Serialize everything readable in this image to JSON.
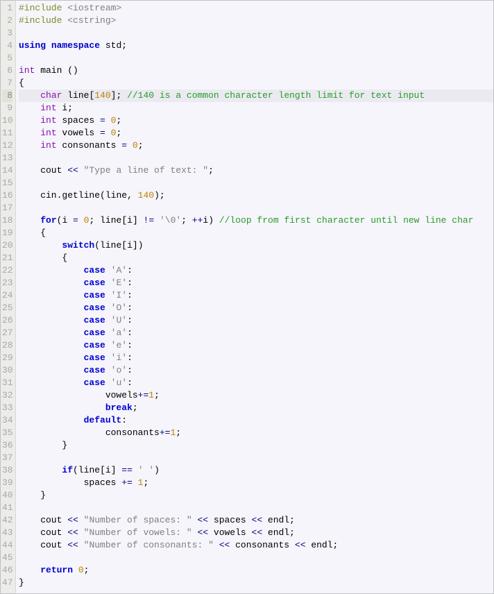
{
  "highlight_line": 8,
  "lines": [
    {
      "n": 1,
      "tokens": [
        [
          "pp",
          "#include "
        ],
        [
          "str",
          "<iostream>"
        ]
      ]
    },
    {
      "n": 2,
      "tokens": [
        [
          "pp",
          "#include "
        ],
        [
          "str",
          "<cstring>"
        ]
      ]
    },
    {
      "n": 3,
      "tokens": []
    },
    {
      "n": 4,
      "tokens": [
        [
          "kw",
          "using"
        ],
        [
          "id",
          " "
        ],
        [
          "kw",
          "namespace"
        ],
        [
          "id",
          " std"
        ],
        [
          "pn",
          ";"
        ]
      ]
    },
    {
      "n": 5,
      "tokens": []
    },
    {
      "n": 6,
      "tokens": [
        [
          "ty",
          "int"
        ],
        [
          "id",
          " main "
        ],
        [
          "pn",
          "()"
        ]
      ]
    },
    {
      "n": 7,
      "tokens": [
        [
          "pn",
          "{"
        ]
      ]
    },
    {
      "n": 8,
      "tokens": [
        [
          "id",
          "    "
        ],
        [
          "ty",
          "char"
        ],
        [
          "id",
          " line"
        ],
        [
          "pn",
          "["
        ],
        [
          "num",
          "140"
        ],
        [
          "pn",
          "]; "
        ],
        [
          "cm",
          "//140 is a common character length limit for text input"
        ]
      ]
    },
    {
      "n": 9,
      "tokens": [
        [
          "id",
          "    "
        ],
        [
          "ty",
          "int"
        ],
        [
          "id",
          " i"
        ],
        [
          "pn",
          ";"
        ]
      ]
    },
    {
      "n": 10,
      "tokens": [
        [
          "id",
          "    "
        ],
        [
          "ty",
          "int"
        ],
        [
          "id",
          " spaces "
        ],
        [
          "op",
          "="
        ],
        [
          "id",
          " "
        ],
        [
          "num",
          "0"
        ],
        [
          "pn",
          ";"
        ]
      ]
    },
    {
      "n": 11,
      "tokens": [
        [
          "id",
          "    "
        ],
        [
          "ty",
          "int"
        ],
        [
          "id",
          " vowels "
        ],
        [
          "op",
          "="
        ],
        [
          "id",
          " "
        ],
        [
          "num",
          "0"
        ],
        [
          "pn",
          ";"
        ]
      ]
    },
    {
      "n": 12,
      "tokens": [
        [
          "id",
          "    "
        ],
        [
          "ty",
          "int"
        ],
        [
          "id",
          " consonants "
        ],
        [
          "op",
          "="
        ],
        [
          "id",
          " "
        ],
        [
          "num",
          "0"
        ],
        [
          "pn",
          ";"
        ]
      ]
    },
    {
      "n": 13,
      "tokens": []
    },
    {
      "n": 14,
      "tokens": [
        [
          "id",
          "    cout "
        ],
        [
          "op",
          "<<"
        ],
        [
          "id",
          " "
        ],
        [
          "str",
          "\"Type a line of text: \""
        ],
        [
          "pn",
          ";"
        ]
      ]
    },
    {
      "n": 15,
      "tokens": []
    },
    {
      "n": 16,
      "tokens": [
        [
          "id",
          "    cin"
        ],
        [
          "pn",
          "."
        ],
        [
          "id",
          "getline"
        ],
        [
          "pn",
          "("
        ],
        [
          "id",
          "line"
        ],
        [
          "pn",
          ", "
        ],
        [
          "num",
          "140"
        ],
        [
          "pn",
          ");"
        ]
      ]
    },
    {
      "n": 17,
      "tokens": []
    },
    {
      "n": 18,
      "tokens": [
        [
          "id",
          "    "
        ],
        [
          "kw",
          "for"
        ],
        [
          "pn",
          "("
        ],
        [
          "id",
          "i "
        ],
        [
          "op",
          "="
        ],
        [
          "id",
          " "
        ],
        [
          "num",
          "0"
        ],
        [
          "pn",
          "; "
        ],
        [
          "id",
          "line"
        ],
        [
          "pn",
          "["
        ],
        [
          "id",
          "i"
        ],
        [
          "pn",
          "] "
        ],
        [
          "op",
          "!="
        ],
        [
          "id",
          " "
        ],
        [
          "ch",
          "'\\0'"
        ],
        [
          "pn",
          "; "
        ],
        [
          "op",
          "++"
        ],
        [
          "id",
          "i"
        ],
        [
          "pn",
          ") "
        ],
        [
          "cm",
          "//loop from first character until new line char"
        ]
      ]
    },
    {
      "n": 19,
      "tokens": [
        [
          "id",
          "    "
        ],
        [
          "pn",
          "{"
        ]
      ]
    },
    {
      "n": 20,
      "tokens": [
        [
          "id",
          "        "
        ],
        [
          "kw",
          "switch"
        ],
        [
          "pn",
          "("
        ],
        [
          "id",
          "line"
        ],
        [
          "pn",
          "["
        ],
        [
          "id",
          "i"
        ],
        [
          "pn",
          "])"
        ]
      ]
    },
    {
      "n": 21,
      "tokens": [
        [
          "id",
          "        "
        ],
        [
          "pn",
          "{"
        ]
      ]
    },
    {
      "n": 22,
      "tokens": [
        [
          "id",
          "            "
        ],
        [
          "kw",
          "case"
        ],
        [
          "id",
          " "
        ],
        [
          "ch",
          "'A'"
        ],
        [
          "pn",
          ":"
        ]
      ]
    },
    {
      "n": 23,
      "tokens": [
        [
          "id",
          "            "
        ],
        [
          "kw",
          "case"
        ],
        [
          "id",
          " "
        ],
        [
          "ch",
          "'E'"
        ],
        [
          "pn",
          ":"
        ]
      ]
    },
    {
      "n": 24,
      "tokens": [
        [
          "id",
          "            "
        ],
        [
          "kw",
          "case"
        ],
        [
          "id",
          " "
        ],
        [
          "ch",
          "'I'"
        ],
        [
          "pn",
          ":"
        ]
      ]
    },
    {
      "n": 25,
      "tokens": [
        [
          "id",
          "            "
        ],
        [
          "kw",
          "case"
        ],
        [
          "id",
          " "
        ],
        [
          "ch",
          "'O'"
        ],
        [
          "pn",
          ":"
        ]
      ]
    },
    {
      "n": 26,
      "tokens": [
        [
          "id",
          "            "
        ],
        [
          "kw",
          "case"
        ],
        [
          "id",
          " "
        ],
        [
          "ch",
          "'U'"
        ],
        [
          "pn",
          ":"
        ]
      ]
    },
    {
      "n": 27,
      "tokens": [
        [
          "id",
          "            "
        ],
        [
          "kw",
          "case"
        ],
        [
          "id",
          " "
        ],
        [
          "ch",
          "'a'"
        ],
        [
          "pn",
          ":"
        ]
      ]
    },
    {
      "n": 28,
      "tokens": [
        [
          "id",
          "            "
        ],
        [
          "kw",
          "case"
        ],
        [
          "id",
          " "
        ],
        [
          "ch",
          "'e'"
        ],
        [
          "pn",
          ":"
        ]
      ]
    },
    {
      "n": 29,
      "tokens": [
        [
          "id",
          "            "
        ],
        [
          "kw",
          "case"
        ],
        [
          "id",
          " "
        ],
        [
          "ch",
          "'i'"
        ],
        [
          "pn",
          ":"
        ]
      ]
    },
    {
      "n": 30,
      "tokens": [
        [
          "id",
          "            "
        ],
        [
          "kw",
          "case"
        ],
        [
          "id",
          " "
        ],
        [
          "ch",
          "'o'"
        ],
        [
          "pn",
          ":"
        ]
      ]
    },
    {
      "n": 31,
      "tokens": [
        [
          "id",
          "            "
        ],
        [
          "kw",
          "case"
        ],
        [
          "id",
          " "
        ],
        [
          "ch",
          "'u'"
        ],
        [
          "pn",
          ":"
        ]
      ]
    },
    {
      "n": 32,
      "tokens": [
        [
          "id",
          "                vowels"
        ],
        [
          "op",
          "+="
        ],
        [
          "num",
          "1"
        ],
        [
          "pn",
          ";"
        ]
      ]
    },
    {
      "n": 33,
      "tokens": [
        [
          "id",
          "                "
        ],
        [
          "kw",
          "break"
        ],
        [
          "pn",
          ";"
        ]
      ]
    },
    {
      "n": 34,
      "tokens": [
        [
          "id",
          "            "
        ],
        [
          "kw",
          "default"
        ],
        [
          "pn",
          ":"
        ]
      ]
    },
    {
      "n": 35,
      "tokens": [
        [
          "id",
          "                consonants"
        ],
        [
          "op",
          "+="
        ],
        [
          "num",
          "1"
        ],
        [
          "pn",
          ";"
        ]
      ]
    },
    {
      "n": 36,
      "tokens": [
        [
          "id",
          "        "
        ],
        [
          "pn",
          "}"
        ]
      ]
    },
    {
      "n": 37,
      "tokens": []
    },
    {
      "n": 38,
      "tokens": [
        [
          "id",
          "        "
        ],
        [
          "kw",
          "if"
        ],
        [
          "pn",
          "("
        ],
        [
          "id",
          "line"
        ],
        [
          "pn",
          "["
        ],
        [
          "id",
          "i"
        ],
        [
          "pn",
          "] "
        ],
        [
          "op",
          "=="
        ],
        [
          "id",
          " "
        ],
        [
          "ch",
          "' '"
        ],
        [
          "pn",
          ")"
        ]
      ]
    },
    {
      "n": 39,
      "tokens": [
        [
          "id",
          "            spaces "
        ],
        [
          "op",
          "+="
        ],
        [
          "id",
          " "
        ],
        [
          "num",
          "1"
        ],
        [
          "pn",
          ";"
        ]
      ]
    },
    {
      "n": 40,
      "tokens": [
        [
          "id",
          "    "
        ],
        [
          "pn",
          "}"
        ]
      ]
    },
    {
      "n": 41,
      "tokens": []
    },
    {
      "n": 42,
      "tokens": [
        [
          "id",
          "    cout "
        ],
        [
          "op",
          "<<"
        ],
        [
          "id",
          " "
        ],
        [
          "str",
          "\"Number of spaces: \""
        ],
        [
          "id",
          " "
        ],
        [
          "op",
          "<<"
        ],
        [
          "id",
          " spaces "
        ],
        [
          "op",
          "<<"
        ],
        [
          "id",
          " endl"
        ],
        [
          "pn",
          ";"
        ]
      ]
    },
    {
      "n": 43,
      "tokens": [
        [
          "id",
          "    cout "
        ],
        [
          "op",
          "<<"
        ],
        [
          "id",
          " "
        ],
        [
          "str",
          "\"Number of vowels: \""
        ],
        [
          "id",
          " "
        ],
        [
          "op",
          "<<"
        ],
        [
          "id",
          " vowels "
        ],
        [
          "op",
          "<<"
        ],
        [
          "id",
          " endl"
        ],
        [
          "pn",
          ";"
        ]
      ]
    },
    {
      "n": 44,
      "tokens": [
        [
          "id",
          "    cout "
        ],
        [
          "op",
          "<<"
        ],
        [
          "id",
          " "
        ],
        [
          "str",
          "\"Number of consonants: \""
        ],
        [
          "id",
          " "
        ],
        [
          "op",
          "<<"
        ],
        [
          "id",
          " consonants "
        ],
        [
          "op",
          "<<"
        ],
        [
          "id",
          " endl"
        ],
        [
          "pn",
          ";"
        ]
      ]
    },
    {
      "n": 45,
      "tokens": []
    },
    {
      "n": 46,
      "tokens": [
        [
          "id",
          "    "
        ],
        [
          "kw",
          "return"
        ],
        [
          "id",
          " "
        ],
        [
          "num",
          "0"
        ],
        [
          "pn",
          ";"
        ]
      ]
    },
    {
      "n": 47,
      "tokens": [
        [
          "pn",
          "}"
        ]
      ]
    }
  ]
}
